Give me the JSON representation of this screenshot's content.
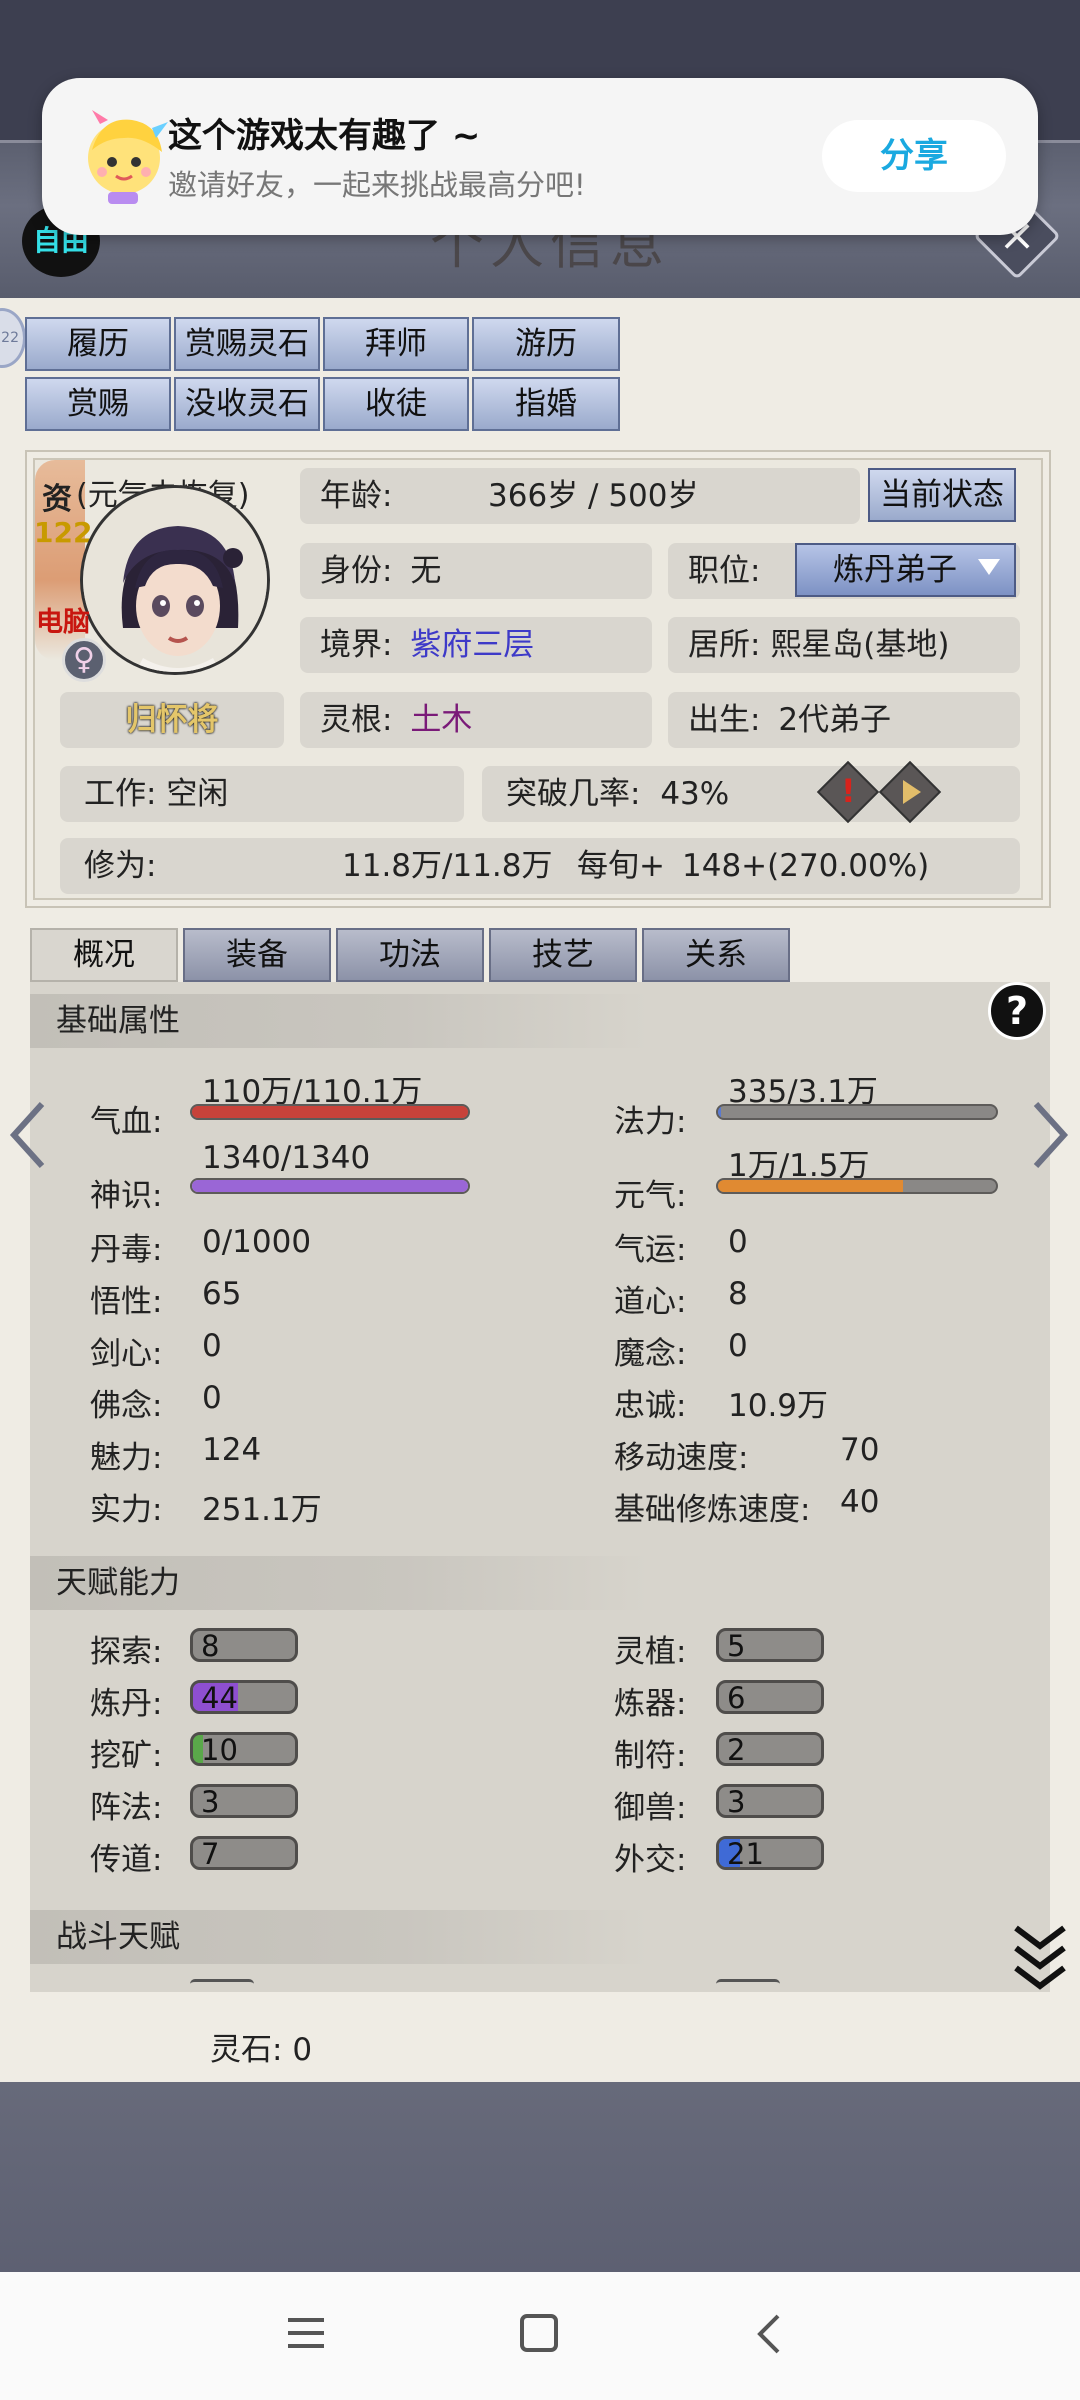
{
  "toast": {
    "title": "这个游戏太有趣了 ~",
    "subtitle": "邀请好友，一起来挑战最高分吧!",
    "share": "分享"
  },
  "window": {
    "title": "个人信息",
    "auto_label": "自由",
    "side_bubble": "22",
    "close": "×"
  },
  "top_tabs": [
    [
      "履历",
      "赏赐灵石",
      "拜师",
      "游历"
    ],
    [
      "赏赐",
      "没收灵石",
      "收徒",
      "指婚"
    ]
  ],
  "profile": {
    "aptitude_label": "资",
    "aptitude_value": "122",
    "status_note": "(元气未恢复)",
    "controller": "电脑",
    "gender": "♀",
    "name": "归怀将",
    "age_label": "年龄:",
    "age_value": "366岁 / 500岁",
    "status_button": "当前状态",
    "identity_label": "身份:",
    "identity_value": "无",
    "position_label": "职位:",
    "position_value": "炼丹弟子",
    "realm_label": "境界:",
    "realm_value": "紫府三层",
    "residence_label": "居所:",
    "residence_value": "熙星岛(基地)",
    "root_label": "灵根:",
    "root_value": "土木",
    "birth_label": "出生:",
    "birth_value": "2代弟子",
    "work_label": "工作:",
    "work_value": "空闲",
    "breakthrough_label": "突破几率:",
    "breakthrough_value": "43%",
    "cultivation_label": "修为:",
    "cultivation_value": "11.8万/11.8万",
    "per_turn_label": "每旬+",
    "per_turn_value": "148+(270.00%)"
  },
  "sub_tabs": [
    "概况",
    "装备",
    "功法",
    "技艺",
    "关系"
  ],
  "basic": {
    "header": "基础属性",
    "help": "?",
    "hp": {
      "label": "气血:",
      "value": "110万/110.1万",
      "fill": 0.999,
      "color": "#c8423a"
    },
    "mana": {
      "label": "法力:",
      "value": "335/3.1万",
      "fill": 0.01,
      "color": "#5a7ad0"
    },
    "sense": {
      "label": "神识:",
      "value": "1340/1340",
      "fill": 1.0,
      "color": "#9a66d6"
    },
    "vital": {
      "label": "元气:",
      "value": "1万/1.5万",
      "fill": 0.667,
      "color": "#e08a32"
    },
    "rows": [
      [
        {
          "label": "丹毒:",
          "value": "0/1000"
        },
        {
          "label": "气运:",
          "value": "0"
        }
      ],
      [
        {
          "label": "悟性:",
          "value": "65"
        },
        {
          "label": "道心:",
          "value": "8"
        }
      ],
      [
        {
          "label": "剑心:",
          "value": "0"
        },
        {
          "label": "魔念:",
          "value": "0"
        }
      ],
      [
        {
          "label": "佛念:",
          "value": "0"
        },
        {
          "label": "忠诚:",
          "value": "10.9万"
        }
      ],
      [
        {
          "label": "魅力:",
          "value": "124"
        },
        {
          "label": "移动速度:",
          "value": "70"
        }
      ],
      [
        {
          "label": "实力:",
          "value": "251.1万"
        },
        {
          "label": "基础修炼速度:",
          "value": "40"
        }
      ]
    ]
  },
  "talents": {
    "header": "天赋能力",
    "rows": [
      [
        {
          "label": "探索:",
          "value": "8",
          "fill": 0.0,
          "color": "#888"
        },
        {
          "label": "灵植:",
          "value": "5",
          "fill": 0.0,
          "color": "#888"
        }
      ],
      [
        {
          "label": "炼丹:",
          "value": "44",
          "fill": 0.44,
          "color": "#8e4fd0"
        },
        {
          "label": "炼器:",
          "value": "6",
          "fill": 0.0,
          "color": "#888"
        }
      ],
      [
        {
          "label": "挖矿:",
          "value": "10",
          "fill": 0.1,
          "color": "#5aa84a"
        },
        {
          "label": "制符:",
          "value": "2",
          "fill": 0.0,
          "color": "#888"
        }
      ],
      [
        {
          "label": "阵法:",
          "value": "3",
          "fill": 0.0,
          "color": "#888"
        },
        {
          "label": "御兽:",
          "value": "3",
          "fill": 0.0,
          "color": "#888"
        }
      ],
      [
        {
          "label": "传道:",
          "value": "7",
          "fill": 0.0,
          "color": "#888"
        },
        {
          "label": "外交:",
          "value": "21",
          "fill": 0.21,
          "color": "#3f6ad6"
        }
      ]
    ]
  },
  "combat": {
    "header": "战斗天赋"
  },
  "spirit_stone": {
    "label": "灵石:",
    "value": "0"
  }
}
